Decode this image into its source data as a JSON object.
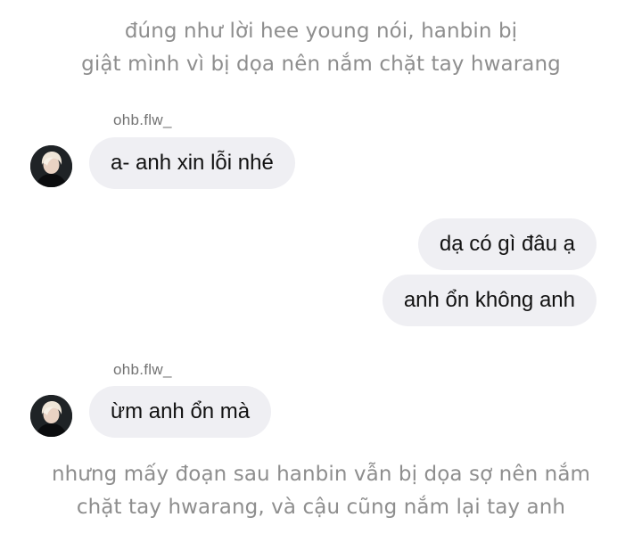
{
  "narration_top": {
    "line1": "đúng như lời hee young nói, hanbin bị",
    "line2": "giật mình vì bị dọa nên nắm chặt tay hwarang"
  },
  "thread": [
    {
      "username": "ohb.flw_",
      "message": "a- anh xin lỗi nhé"
    },
    {
      "outgoing": [
        "dạ có gì đâu ạ",
        "anh ổn không anh"
      ]
    },
    {
      "username": "ohb.flw_",
      "message": "ừm anh ổn mà"
    }
  ],
  "narration_bottom": {
    "line1": "nhưng mấy đoạn sau hanbin vẫn bị dọa sợ nên nắm",
    "line2": "chặt tay hwarang, và cậu cũng nắm lại tay anh"
  },
  "colors": {
    "bubble_bg": "#efeff3",
    "narration_text": "#8e8e8e",
    "username_text": "#737373",
    "message_text": "#111111"
  },
  "icons": {
    "avatar": "profile-photo-avatar"
  }
}
